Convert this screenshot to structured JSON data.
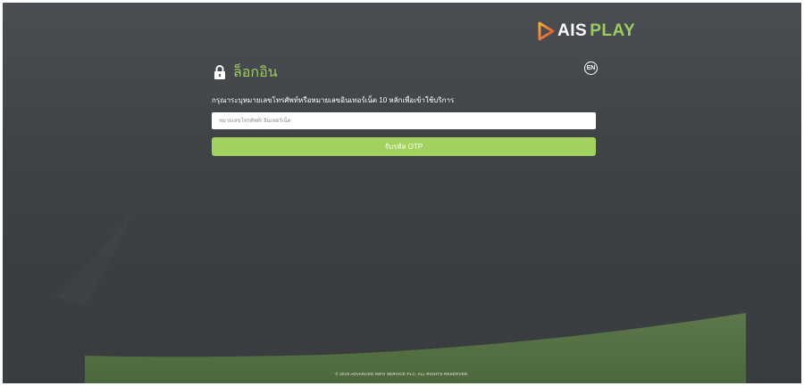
{
  "brand": {
    "name_part1": "AIS",
    "name_part2": "PLAY",
    "accent_color": "#9ccc5c"
  },
  "login": {
    "title": "ล็อกอิน",
    "lock_icon": "lock-icon",
    "language_label": "EN",
    "instruction": "กรุณาระบุหมายเลขโทรศัพท์หรือหมายเลขอินเทอร์เน็ต 10 หลักเพื่อเข้าใช้บริการ",
    "phone_placeholder": "หมายเลขโทรศัพท์/ อินเทอร์เน็ต",
    "otp_button_label": "รับรหัส OTP"
  },
  "footer": {
    "copyright": "© 2019 ADVANCED INFO SERVICE PLC. ALL RIGHTS RESERVED."
  }
}
